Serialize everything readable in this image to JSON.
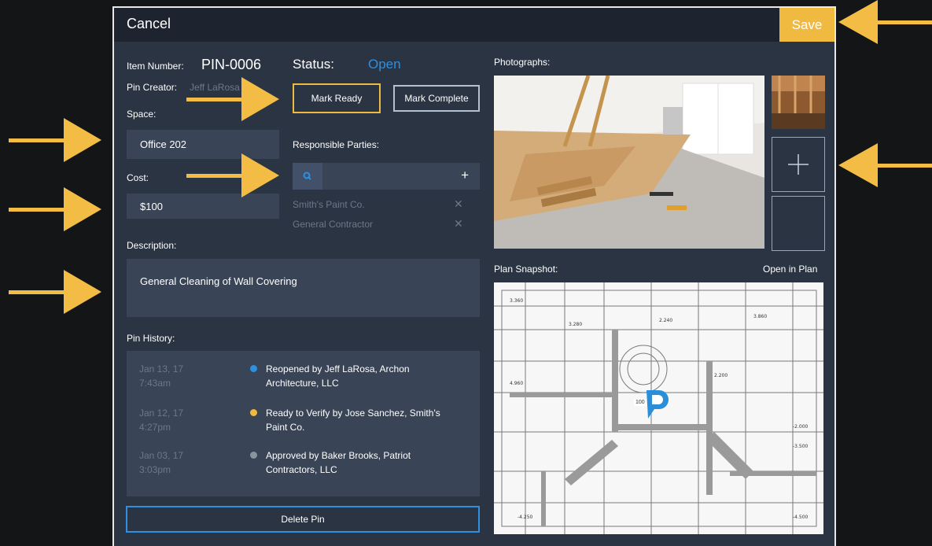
{
  "header": {
    "cancel_label": "Cancel",
    "save_label": "Save"
  },
  "item": {
    "number_label": "Item Number:",
    "number_value": "PIN-0006",
    "creator_label": "Pin Creator:",
    "creator_value": "Jeff LaRosa"
  },
  "status": {
    "label": "Status:",
    "value": "Open",
    "mark_ready_label": "Mark Ready",
    "mark_complete_label": "Mark Complete"
  },
  "space": {
    "label": "Space:",
    "value": "Office 202"
  },
  "cost": {
    "label": "Cost:",
    "value": "$100"
  },
  "responsible": {
    "label": "Responsible Parties:",
    "search_placeholder": "",
    "parties": [
      "Smith's Paint Co.",
      "General Contractor"
    ]
  },
  "description": {
    "label": "Description:",
    "value": "General Cleaning of Wall Covering"
  },
  "history": {
    "label": "Pin History:",
    "entries": [
      {
        "date": "Jan 13, 17",
        "time": "7:43am",
        "line1": "Reopened by Jeff LaRosa, Archon",
        "line2": "Architecture, LLC",
        "dot_color": "#2f8fe0"
      },
      {
        "date": "Jan 12, 17",
        "time": "4:27pm",
        "line1": "Ready to Verify by Jose Sanchez, Smith's",
        "line2": "Paint Co.",
        "dot_color": "#f0b93f"
      },
      {
        "date": "Jan 03, 17",
        "time": "3:03pm",
        "line1": "Approved by Baker Brooks, Patriot",
        "line2": "Contractors, LLC",
        "dot_color": "#8b93a0"
      }
    ]
  },
  "delete_label": "Delete Pin",
  "photos": {
    "label": "Photographs:"
  },
  "plan": {
    "label": "Plan Snapshot:",
    "open_label": "Open in Plan",
    "pin_number": "100"
  },
  "colors": {
    "accent": "#f0b93f",
    "status_blue": "#2f8fe0",
    "panel": "#2b3443"
  }
}
